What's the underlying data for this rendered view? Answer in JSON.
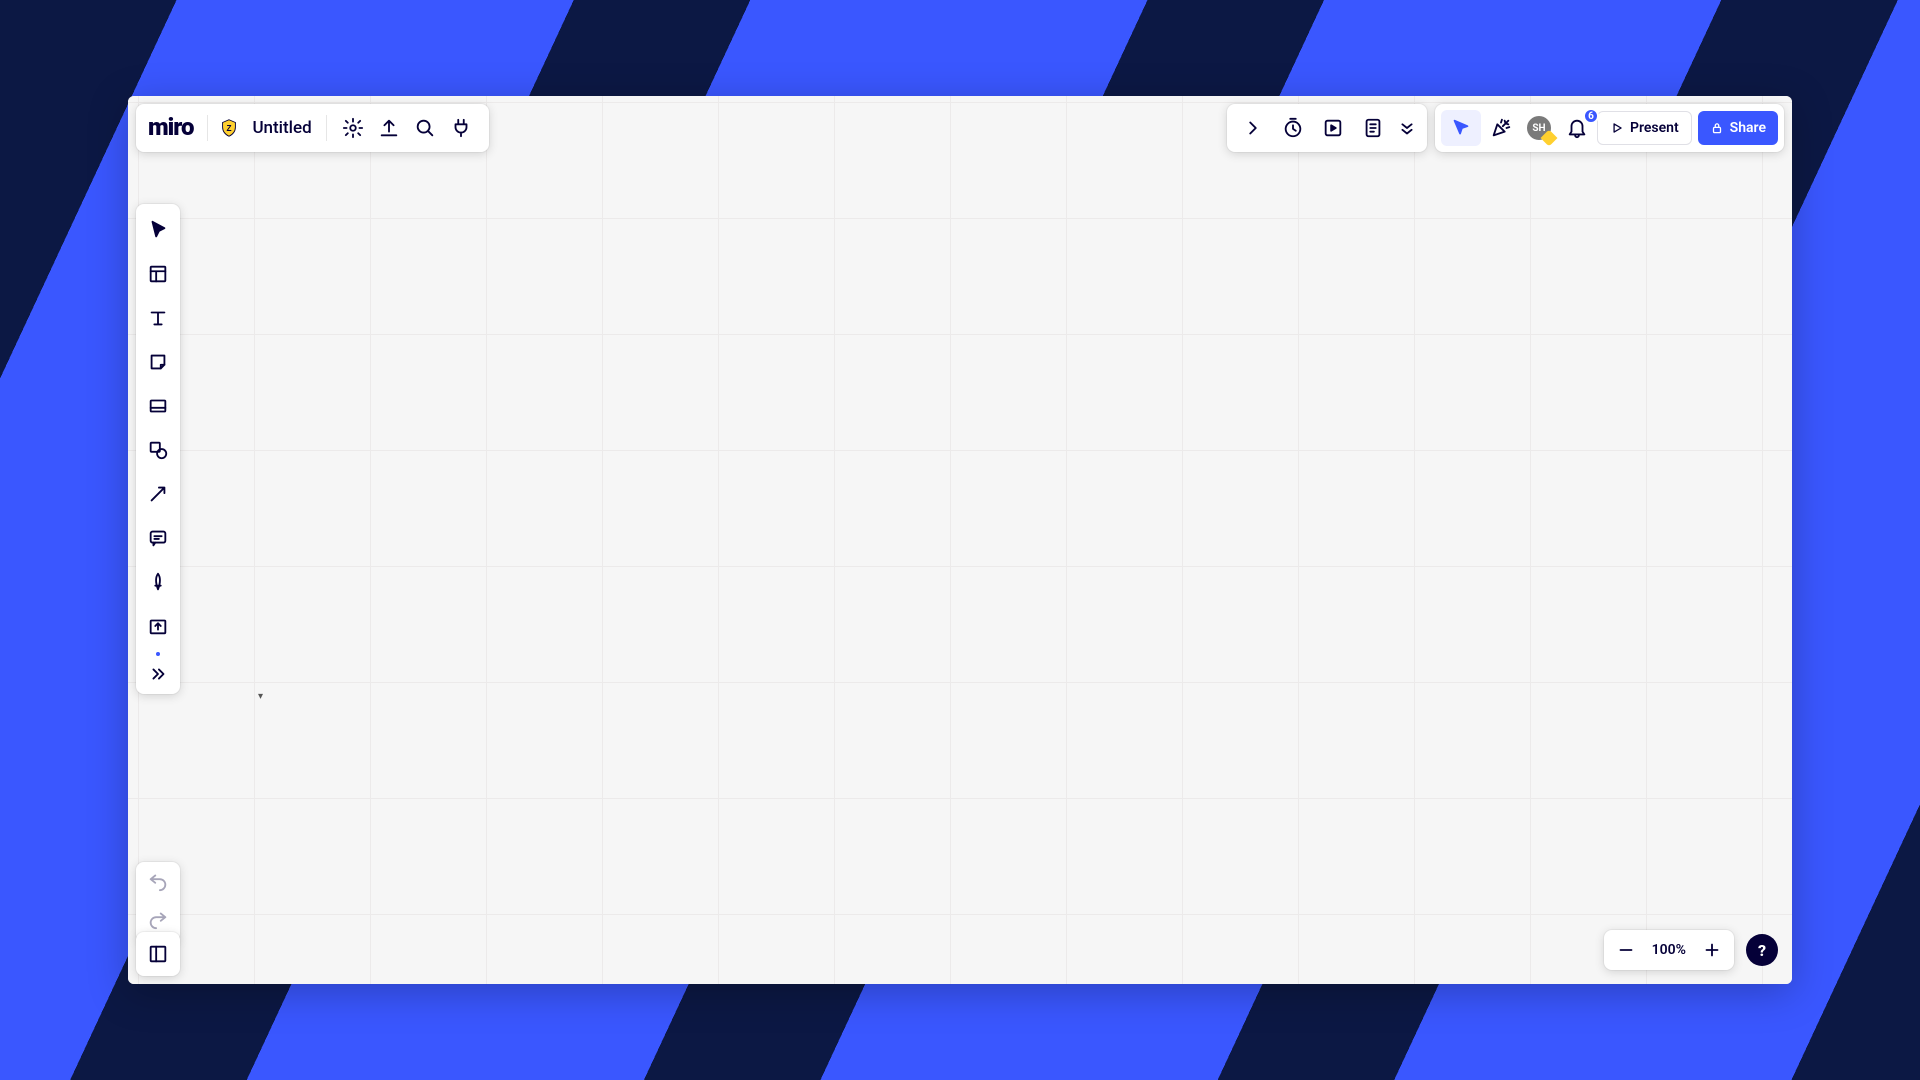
{
  "app": {
    "logo_text": "miro",
    "board_title": "Untitled"
  },
  "header_icons": {
    "shield": "shield-icon",
    "settings": "settings-icon",
    "upload": "upload-icon",
    "search": "search-icon",
    "plug": "plug-icon"
  },
  "collab": {
    "avatar_initials": "SH",
    "notification_count": "6",
    "present_label": "Present",
    "share_label": "Share"
  },
  "toolbar": {
    "items": [
      "select",
      "templates",
      "text",
      "sticky",
      "frame",
      "shapes",
      "arrow",
      "comment",
      "pen",
      "upload-frame",
      "more"
    ]
  },
  "zoom": {
    "level": "100%"
  },
  "help": {
    "label": "?"
  },
  "colors": {
    "accent": "#3a57ff",
    "bg_dark_stripe": "#0c1844",
    "bg_light_stripe": "#3a57ff",
    "ink": "#050038"
  }
}
